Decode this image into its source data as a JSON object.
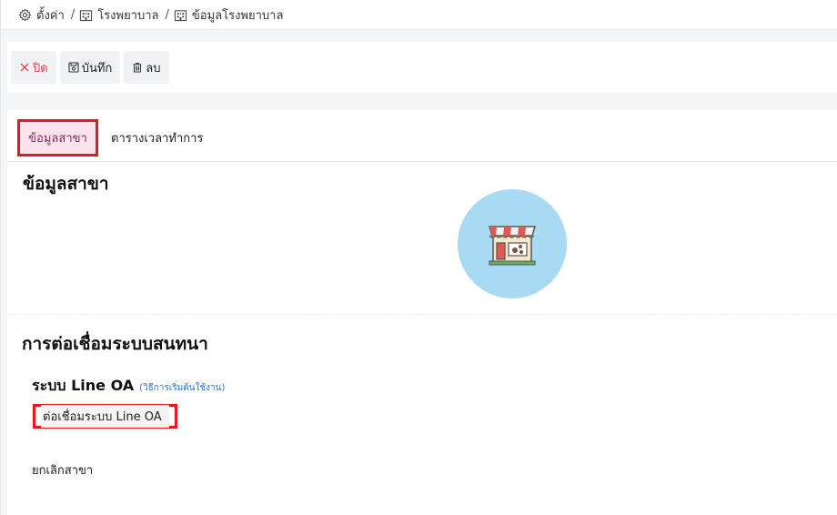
{
  "breadcrumb": [
    {
      "label": "ตั้งค่า",
      "icon": "gear-icon"
    },
    {
      "label": "โรงพยาบาล",
      "icon": "building-icon"
    },
    {
      "label": "ข้อมูลโรงพยาบาล",
      "icon": "building-icon"
    }
  ],
  "breadcrumb_separator": "/",
  "toolbar": {
    "close_label": "ปิด",
    "save_label": "บันทึก",
    "delete_label": "ลบ"
  },
  "tabs": [
    {
      "label": "ข้อมูลสาขา",
      "active": true
    },
    {
      "label": "ตารางเวลาทำการ",
      "active": false
    }
  ],
  "branch_section": {
    "title": "ข้อมูลสาขา",
    "logo_icon": "shop-icon"
  },
  "chat_section": {
    "title": "การต่อเชื่อมระบบสนทนา",
    "line_oa_title": "ระบบ Line OA",
    "line_oa_help_link": "(วิธีการเริ่มต้นใช้งาน)",
    "connect_button_label": "ต่อเชื่อมระบบ Line OA"
  },
  "cancel_branch_label": "ยกเลิกสาขา",
  "colors": {
    "highlight": "#e8171f",
    "active_tab_bg": "#fbe4ee",
    "logo_bg": "#a8daf4",
    "link": "#2f6fd6"
  }
}
